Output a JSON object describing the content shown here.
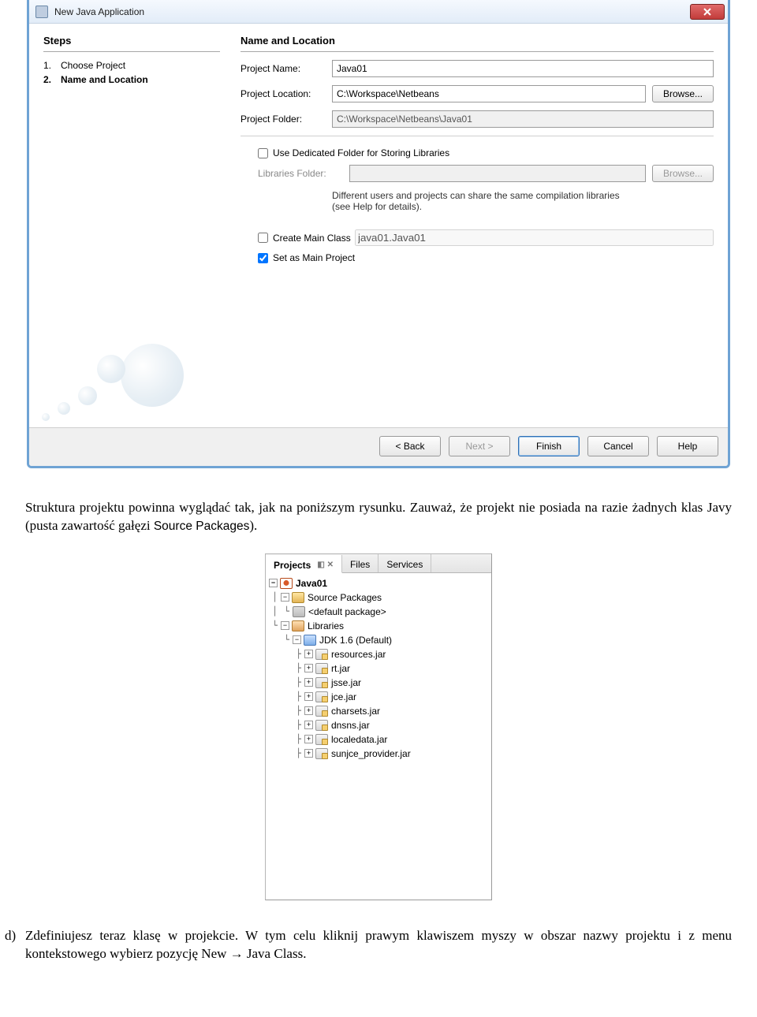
{
  "dialog": {
    "title": "New Java Application",
    "steps_title": "Steps",
    "form_title": "Name and Location",
    "steps": [
      {
        "num": "1.",
        "label": "Choose Project",
        "active": false
      },
      {
        "num": "2.",
        "label": "Name and Location",
        "active": true
      }
    ],
    "fields": {
      "project_name_label": "Project Name:",
      "project_name_value": "Java01",
      "project_location_label": "Project Location:",
      "project_location_value": "C:\\Workspace\\Netbeans",
      "project_folder_label": "Project Folder:",
      "project_folder_value": "C:\\Workspace\\Netbeans\\Java01",
      "browse_label": "Browse...",
      "use_dedicated_label": "Use Dedicated Folder for Storing Libraries",
      "libraries_folder_label": "Libraries Folder:",
      "hint": "Different users and projects can share the same compilation libraries (see Help for details).",
      "create_main_label": "Create Main Class",
      "create_main_value": "java01.Java01",
      "set_main_label": "Set as Main Project"
    },
    "check_state": {
      "use_dedicated": false,
      "create_main": false,
      "set_main": true
    },
    "buttons": {
      "back": "< Back",
      "next": "Next >",
      "finish": "Finish",
      "cancel": "Cancel",
      "help": "Help"
    },
    "close_label": "X"
  },
  "doc_para1": "Struktura projektu powinna wyglądać tak, jak na poniższym rysunku. Zauważ, że projekt nie posiada na razie żadnych klas Javy (pusta zawartość gałęzi ",
  "doc_para1_sans": "Source Packages",
  "doc_para1_end": ").",
  "tree": {
    "tabs": {
      "projects": "Projects",
      "files": "Files",
      "services": "Services"
    },
    "root": "Java01",
    "source_packages": "Source Packages",
    "default_package": "<default package>",
    "libraries": "Libraries",
    "jdk": "JDK 1.6 (Default)",
    "jars": [
      "resources.jar",
      "rt.jar",
      "jsse.jar",
      "jce.jar",
      "charsets.jar",
      "dnsns.jar",
      "localedata.jar",
      "sunjce_provider.jar"
    ]
  },
  "doc_list_marker": "d)",
  "doc_list_text_1": "Zdefiniujesz teraz klasę w projekcie. W tym celu kliknij prawym klawiszem myszy w obszar nazwy projektu i z menu kontekstowego wybierz pozycję ",
  "doc_list_sans": "New → Java Class",
  "doc_list_end": "."
}
